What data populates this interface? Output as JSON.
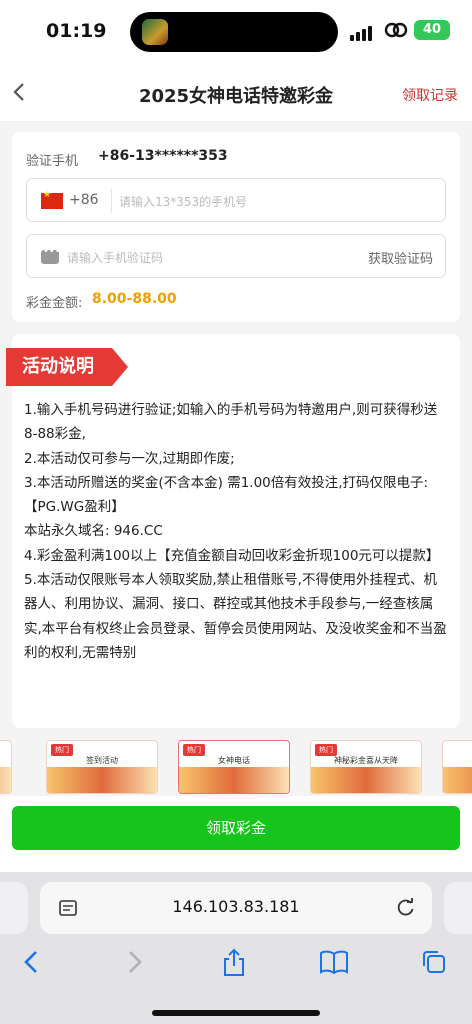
{
  "status": {
    "time": "01:19",
    "battery": "40"
  },
  "nav": {
    "title": "2025女神电话特邀彩金",
    "right_link": "领取记录"
  },
  "form": {
    "verify_label": "验证手机",
    "verify_number": "+86-13******353",
    "country_code": "+86",
    "phone_placeholder": "请输入13*353的手机号",
    "code_placeholder": "请输入手机验证码",
    "get_code": "获取验证码",
    "amount_label": "彩金金额:",
    "amount_value": "8.00-88.00"
  },
  "activity": {
    "title": "活动说明",
    "lines": [
      "1.输入手机号码进行验证;如输入的手机号码为特邀用户,则可获得秒送8-88彩金,",
      "2.本活动仅可参与一次,过期即作废;",
      "3.本活动所赠送的奖金(不含本金) 需1.00倍有效投注,打码仅限电子:【PG.WG盈利】",
      "本站永久域名: 946.CC",
      "4.彩金盈利满100以上【充值金额自动回收彩金折现100元可以提款】",
      "5.本活动仅限账号本人领取奖励,禁止租借账号,不得使用外挂程式、机器人、利用协议、漏洞、接口、群控或其他技术手段参与,一经查核属实,本平台有权终止会员登录、暂停会员使用网站、及没收奖金和不当盈利的权利,无需特别"
    ]
  },
  "promos": [
    {
      "tag": "热门",
      "title": "签到活动"
    },
    {
      "tag": "热门",
      "title": "女神电话"
    },
    {
      "tag": "热门",
      "title": "神秘彩金喜从天降"
    }
  ],
  "button": {
    "claim": "领取彩金"
  },
  "browser": {
    "url": "146.103.83.181"
  }
}
